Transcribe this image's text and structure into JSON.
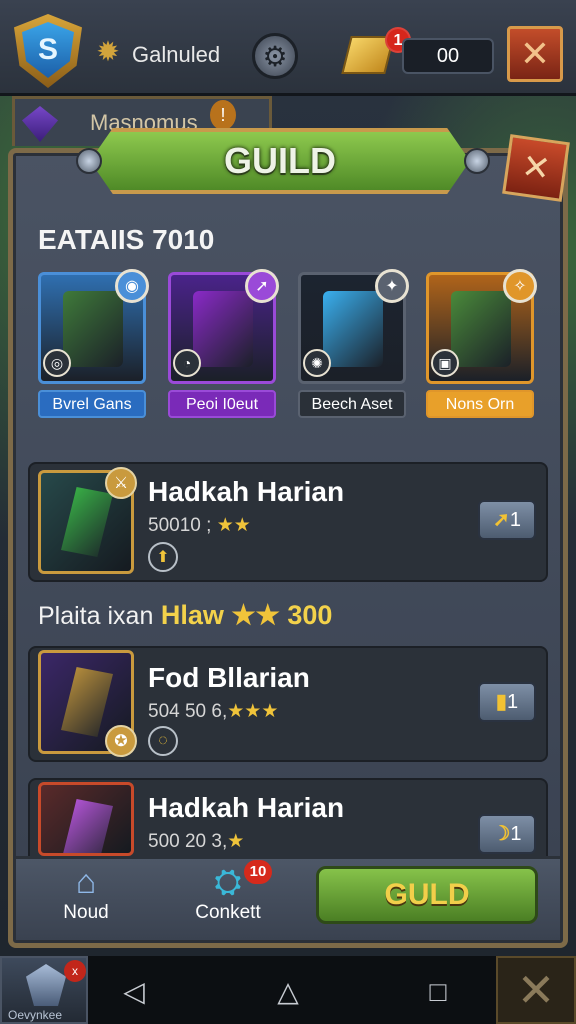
{
  "topbar": {
    "shield_letter": "S",
    "player_name": "Galnuled",
    "notification_count": "1",
    "currency_value": "00"
  },
  "tab_strip": {
    "label": "Masnomus",
    "badge": "!"
  },
  "panel": {
    "title": "GUILD",
    "section_title": "EATAIIS 7010"
  },
  "reward_cards": [
    {
      "label": "Bvrel Gans",
      "border": "#4a8fd8",
      "bg": "#2f6fb0",
      "art": "#3f7a3a",
      "label_bg": "#2a6cc0"
    },
    {
      "label": "Peoi I0eut",
      "border": "#9a4ad8",
      "bg": "#4a238a",
      "art": "#8a2ac8",
      "label_bg": "#7a2ab8"
    },
    {
      "label": "Beech Aset",
      "border": "#5a6270",
      "bg": "#1c2430",
      "art": "#3ab0f0",
      "label_bg": "#2a3038"
    },
    {
      "label": "Nons Orn",
      "border": "#e0962a",
      "bg": "#b0641a",
      "art": "#4a8a3a",
      "label_bg": "#e8a02a"
    }
  ],
  "rows": [
    {
      "name": "Hadkah Harian",
      "sub_text": "50010 ;",
      "stars": "★★",
      "button": "1",
      "gem_color": "#3cc04a",
      "thumb_bg": "#27494a"
    },
    {
      "name": "Fod Bllarian",
      "sub_text": "504 50 6,",
      "stars": "★★★",
      "button": "1",
      "gem_color": "#c89a3e",
      "thumb_bg": "#3b2768"
    },
    {
      "name": "Hadkah Harian",
      "sub_text": "500 20 3,",
      "stars": "★",
      "button": "1",
      "gem_color": "#c35ae8",
      "thumb_bg": "#5a2a2a"
    }
  ],
  "subheader": {
    "text_a": "Plaita ixan",
    "text_b": "Hlaw",
    "stars": "★★",
    "value": "300"
  },
  "bottom_nav": {
    "home_label": "Noud",
    "connect_label": "Conkett",
    "connect_badge": "10",
    "guild_button": "GULD"
  },
  "corner_app": {
    "label": "Oevynkee",
    "badge": "x"
  },
  "icons": {
    "shield": "shield-icon",
    "settings": "gear-icon",
    "gold": "gold-bar-icon",
    "close": "close-icon",
    "home": "house-icon",
    "connect": "cannon-icon",
    "back": "back-triangle-icon",
    "home_sys": "home-triangle-icon",
    "recents": "square-icon"
  }
}
